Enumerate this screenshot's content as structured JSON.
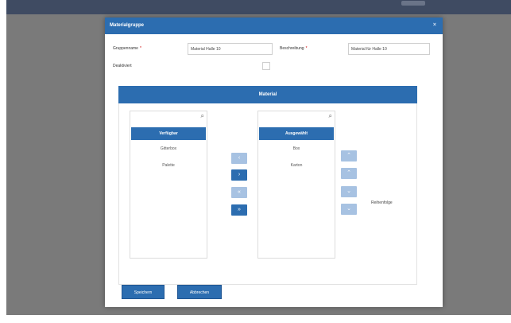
{
  "dialog": {
    "title": "Materialgruppe",
    "close_glyph": "×"
  },
  "form": {
    "group_name_label": "Gruppenname",
    "group_name_value": "Material Halle 10",
    "description_label": "Beschreibung",
    "description_value": "Material für Halle 10",
    "required_marker": "*",
    "deactivated_label": "Deaktiviert",
    "deactivated_checked": false
  },
  "material": {
    "section_title": "Material",
    "available": {
      "header": "Verfügbar",
      "items": [
        "Gitterbox",
        "Palette"
      ]
    },
    "selected": {
      "header": "Ausgewählt",
      "items": [
        "Box",
        "Karton"
      ]
    },
    "transfer_buttons": [
      "‹",
      "›",
      "«",
      "»"
    ],
    "order_buttons": [
      "⌃",
      "⌃",
      "⌄",
      "⌄"
    ],
    "order_hint": "Reihenfolge"
  },
  "footer": {
    "save_label": "Speichern",
    "cancel_label": "Abbrechen"
  },
  "colors": {
    "primary": "#2c6db0",
    "disabled": "#a7c2e2",
    "backdrop": "#7a7a7a"
  }
}
